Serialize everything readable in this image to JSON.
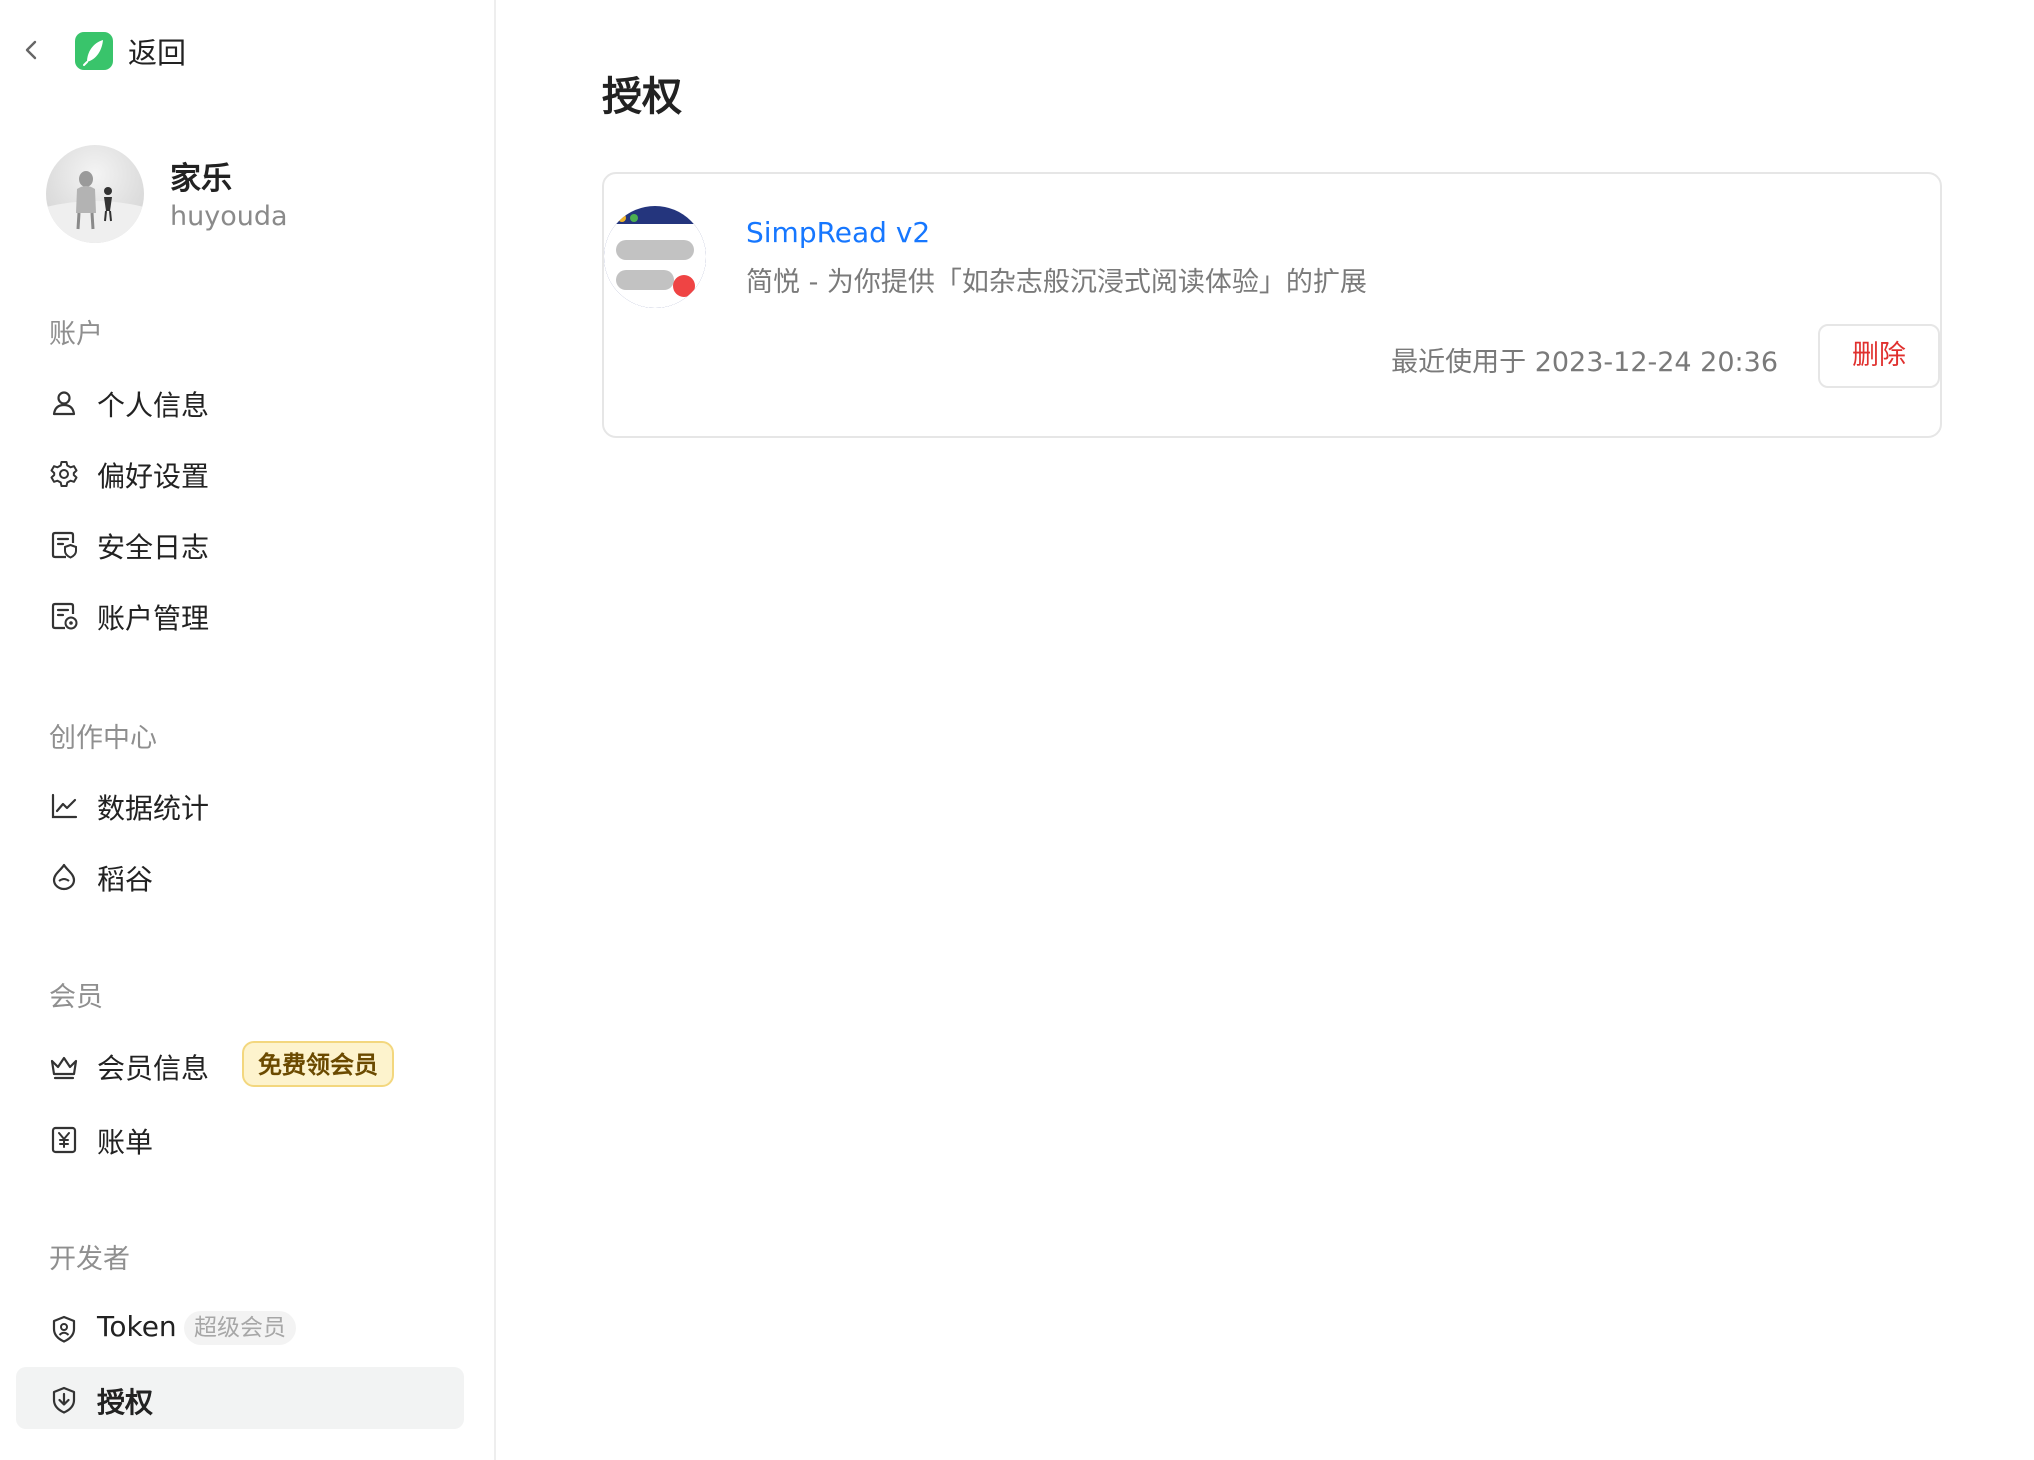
{
  "topbar": {
    "back_label": "返回"
  },
  "profile": {
    "name": "家乐",
    "handle": "huyouda"
  },
  "sidebar": {
    "sections": {
      "account": "账户",
      "creator": "创作中心",
      "member": "会员",
      "developer": "开发者"
    },
    "items": {
      "personal_info": "个人信息",
      "preferences": "偏好设置",
      "security_log": "安全日志",
      "account_manage": "账户管理",
      "statistics": "数据统计",
      "daogu": "稻谷",
      "member_info": "会员信息",
      "member_badge": "免费领会员",
      "bills": "账单",
      "token": "Token",
      "token_badge": "超级会员",
      "authorization": "授权"
    },
    "active_item": "authorization"
  },
  "main": {
    "title": "授权",
    "apps": [
      {
        "name": "SimpRead v2",
        "description": "简悦 - 为你提供「如杂志般沉浸式阅读体验」的扩展",
        "last_used": "最近使用于 2023-12-24 20:36",
        "delete_label": "删除"
      }
    ]
  },
  "colors": {
    "accent_link": "#1677ff",
    "danger": "#e0302e",
    "logo_green": "#39c46b",
    "active_bg": "#f2f3f3",
    "badge_bg": "#fdf3cd"
  },
  "icons": {
    "back": "chevron-left-icon",
    "personal_info": "user-icon",
    "preferences": "gear-icon",
    "security_log": "document-shield-icon",
    "account_manage": "document-settings-icon",
    "statistics": "line-chart-icon",
    "daogu": "drop-icon",
    "member_info": "crown-icon",
    "bills": "yuan-icon",
    "token": "shield-user-icon",
    "authorization": "download-shield-icon"
  }
}
